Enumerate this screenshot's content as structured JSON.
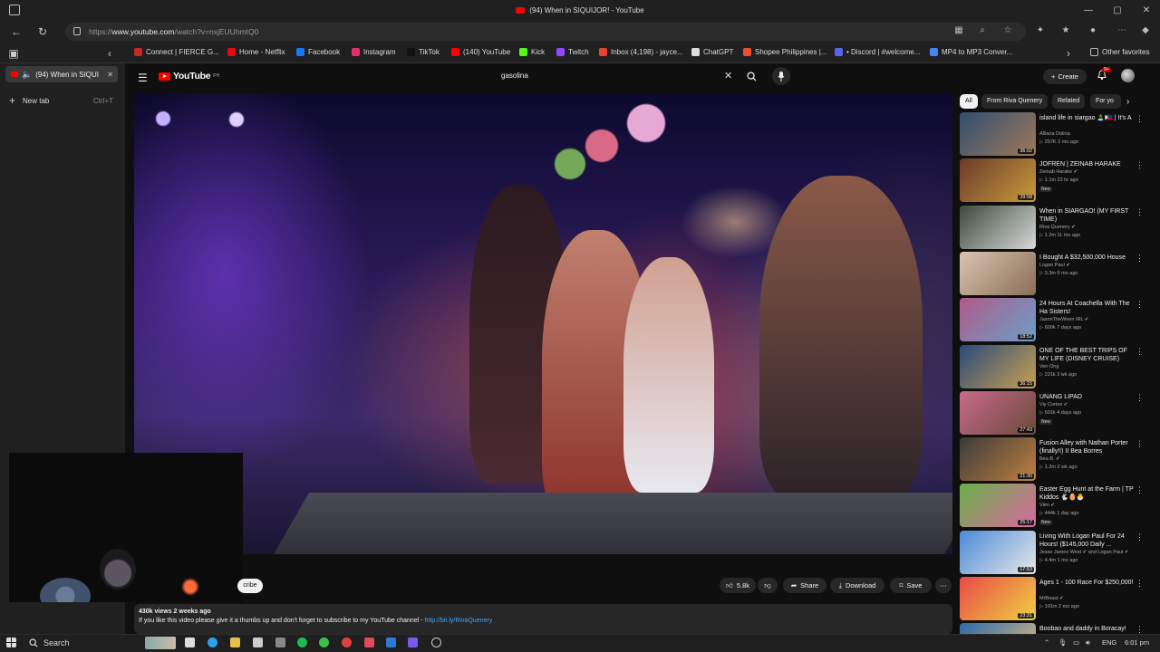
{
  "window": {
    "title": "(94) When in SIQUIJOR! - YouTube",
    "controls": [
      "—",
      "▢",
      "✕"
    ]
  },
  "address": {
    "url_prefix": "https://",
    "url_host": "www.youtube.com",
    "url_path": "/watch?v=nxjEUUhmtQ0"
  },
  "bookmarks": [
    {
      "label": "Connect | FIERCE G...",
      "color": "#c62828"
    },
    {
      "label": "Home - Netflix",
      "color": "#e50914"
    },
    {
      "label": "Facebook",
      "color": "#1877f2"
    },
    {
      "label": "Instagram",
      "color": "#e1306c"
    },
    {
      "label": "TikTok",
      "color": "#111111"
    },
    {
      "label": "(140) YouTube",
      "color": "#ff0000"
    },
    {
      "label": "Kick",
      "color": "#53fc18"
    },
    {
      "label": "Twitch",
      "color": "#9146ff"
    },
    {
      "label": "Inbox (4,198) - jayce...",
      "color": "#ea4335"
    },
    {
      "label": "ChatGPT",
      "color": "#dddddd"
    },
    {
      "label": "Shopee Philippines |...",
      "color": "#ee4d2d"
    },
    {
      "label": "• Discord | #welcome...",
      "color": "#5865f2"
    },
    {
      "label": "MP4 to MP3 Conver...",
      "color": "#4285f4"
    }
  ],
  "other_favorites": "Other favorites",
  "side_tabs": {
    "active_tab": "(94) When in SIQUIJ",
    "new_tab": "New tab",
    "new_tab_shortcut": "Ctrl+T"
  },
  "header": {
    "logo": "YouTube",
    "logo_region": "PH",
    "search_value": "gasolina",
    "create_label": "Create",
    "notifications": "9+"
  },
  "video_actions": {
    "subscribe_fragment": "cribe",
    "likes": "5.8k",
    "share": "Share",
    "download": "Download",
    "save": "Save"
  },
  "description": {
    "stats": "430k views  2 weeks ago",
    "text": "If you like this video please give it a thumbs up and don't forget to subscribe to my YouTube channel - ",
    "link": "http://bit.ly/RivaQuenery"
  },
  "chips": [
    "All",
    "From Riva Quenery",
    "Related",
    "For yo"
  ],
  "recommendations": [
    {
      "title": "island life in siargao 🏝️🇵🇭 | It's A",
      "channel": "Alliana Dolina",
      "meta": "▷ 257K  2 mo ago",
      "duration": "36:02",
      "new": "",
      "colors": [
        "#2f4f6f",
        "#a0785a"
      ]
    },
    {
      "title": "JOFREN | ZEINAB HARAKE",
      "channel": "Zeinab Harake ✔",
      "meta": "▷ 1.1m  22 hr ago",
      "duration": "39:58",
      "new": "New",
      "colors": [
        "#6b3a2a",
        "#c89b3c"
      ]
    },
    {
      "title": "When in SIARGAO! (MY FIRST TIME)",
      "channel": "Riva Quenery ✔",
      "meta": "▷ 1.2m  11 mo ago",
      "duration": "",
      "new": "",
      "colors": [
        "#3c4a3c",
        "#d8d8d8"
      ]
    },
    {
      "title": "I Bought A $32,500,000 House",
      "channel": "Logan Paul ✔",
      "meta": "▷ 3.3m  6 mo ago",
      "duration": "",
      "new": "",
      "colors": [
        "#d9c4b0",
        "#8a6e58"
      ]
    },
    {
      "title": "24 Hours At Coachella With The Ha Sisters!",
      "channel": "JasonTheWeen IRL ✔",
      "meta": "▷ 600k  7 days ago",
      "duration": "18:52",
      "new": "",
      "colors": [
        "#b05a8a",
        "#6aa0c8"
      ]
    },
    {
      "title": "ONE OF THE BEST TRIPS OF MY LIFE (DISNEY CRUISE)",
      "channel": "Ven Ong",
      "meta": "▷ 221k  3 wk ago",
      "duration": "36:15",
      "new": "",
      "colors": [
        "#2a4a7a",
        "#c8a050"
      ]
    },
    {
      "title": "UNANG LIPAD",
      "channel": "Viy Cortez ✔",
      "meta": "▷ 601k  4 days ago",
      "duration": "27:43",
      "new": "New",
      "colors": [
        "#c86a8a",
        "#6a4a3a"
      ]
    },
    {
      "title": "Fusion Alley with Nathan Porter (finally!!) II Bea Borres",
      "channel": "Bea B. ✔",
      "meta": "▷ 1.2m  2 wk ago",
      "duration": "21:30",
      "new": "",
      "colors": [
        "#3a3a3a",
        "#c08040"
      ]
    },
    {
      "title": "Easter Egg Hunt at the Farm | TP Kiddos 🐇🥚🐣",
      "channel": "Vien ✔",
      "meta": "▷ 444k  1 day ago",
      "duration": "25:17",
      "new": "New",
      "colors": [
        "#6ab04a",
        "#d86aa0"
      ]
    },
    {
      "title": "Living With Logan Paul For 24 Hours! ($145,000 Daily ...",
      "channel": "Jesse James West ✔ and Logan Paul ✔",
      "meta": "▷ 4.4m  1 mo ago",
      "duration": "17:53",
      "new": "",
      "colors": [
        "#4a8ad8",
        "#e8e8e8"
      ]
    },
    {
      "title": "Ages 1 - 100 Race For $250,000!",
      "channel": "MrBeast ✔",
      "meta": "▷ 101m  2 mo ago",
      "duration": "23:31",
      "new": "",
      "colors": [
        "#e84a4a",
        "#f0d040"
      ]
    },
    {
      "title": "Boobao and daddy in Boracay!",
      "channel": "",
      "meta": "",
      "duration": "",
      "new": "",
      "colors": [
        "#2a6aaa",
        "#e8c080"
      ]
    }
  ],
  "taskbar": {
    "search": "Search",
    "lang": "ENG",
    "time": "6:01 pm"
  },
  "accent": "#ff0000"
}
